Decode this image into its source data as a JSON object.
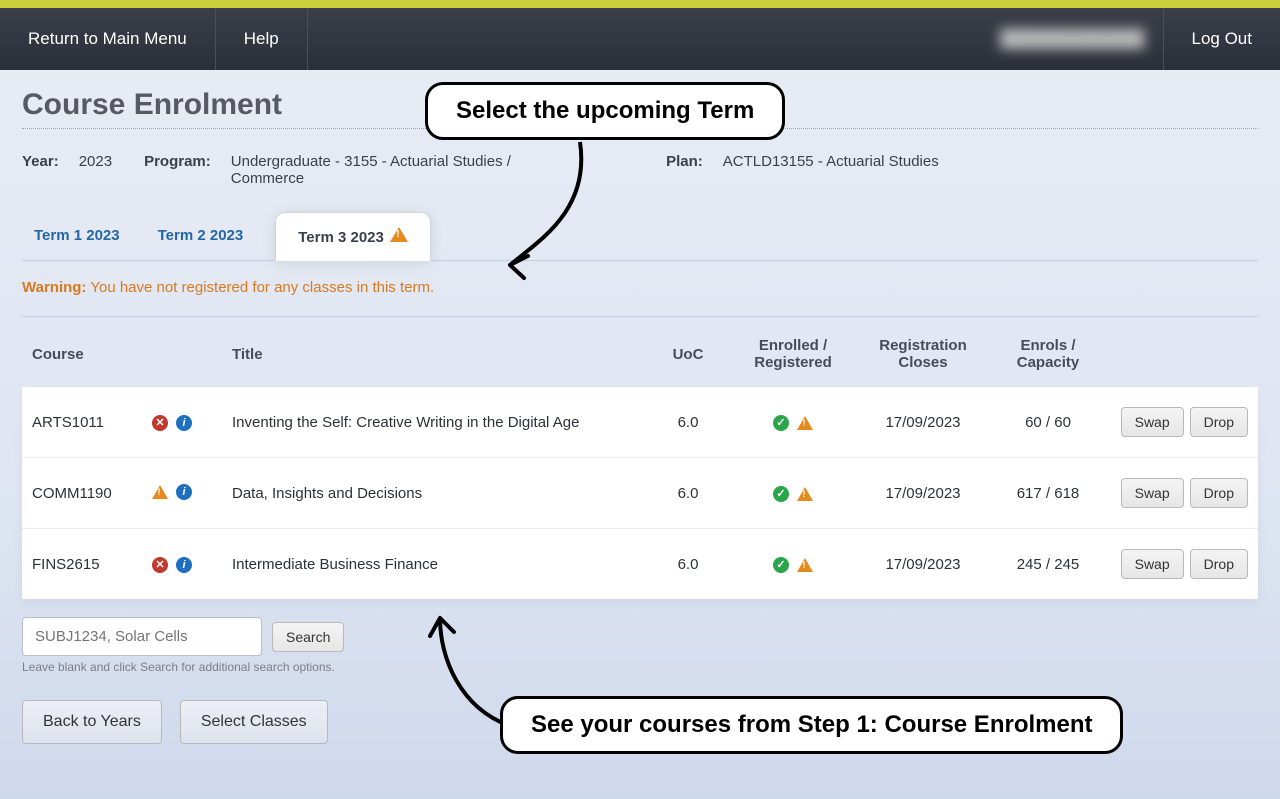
{
  "topnav": {
    "return_label": "Return to Main Menu",
    "help_label": "Help",
    "user_blurred": "████████████",
    "logout_label": "Log Out"
  },
  "page_title": "Course Enrolment",
  "info": {
    "year_label": "Year:",
    "year_value": "2023",
    "program_label": "Program:",
    "program_value": "Undergraduate - 3155 - Actuarial Studies / Commerce",
    "plan_label": "Plan:",
    "plan_value": "ACTLD13155 - Actuarial Studies"
  },
  "tabs": [
    {
      "label": "Term 1 2023",
      "active": false,
      "warn": false
    },
    {
      "label": "Term 2 2023",
      "active": false,
      "warn": false
    },
    {
      "label": "Term 3 2023",
      "active": true,
      "warn": true
    }
  ],
  "warning": {
    "strong": "Warning:",
    "text": "You have not registered for any classes in this term."
  },
  "table": {
    "headers": {
      "course": "Course",
      "title": "Title",
      "uoc": "UoC",
      "enrolled": "Enrolled / Registered",
      "reg_closes": "Registration Closes",
      "capacity": "Enrols / Capacity"
    },
    "rows": [
      {
        "course": "ARTS1011",
        "status_icon": "error",
        "title": "Inventing the Self: Creative Writing in the Digital Age",
        "uoc": "6.0",
        "reg_closes": "17/09/2023",
        "capacity": "60 / 60"
      },
      {
        "course": "COMM1190",
        "status_icon": "warn",
        "title": "Data, Insights and Decisions",
        "uoc": "6.0",
        "reg_closes": "17/09/2023",
        "capacity": "617 / 618"
      },
      {
        "course": "FINS2615",
        "status_icon": "error",
        "title": "Intermediate Business Finance",
        "uoc": "6.0",
        "reg_closes": "17/09/2023",
        "capacity": "245 / 245"
      }
    ],
    "swap_label": "Swap",
    "drop_label": "Drop"
  },
  "search": {
    "placeholder": "SUBJ1234, Solar Cells",
    "button": "Search",
    "hint": "Leave blank and click Search for additional search options."
  },
  "bottom": {
    "back": "Back to Years",
    "select": "Select Classes"
  },
  "callouts": {
    "upper": "Select the upcoming Term",
    "lower": "See your courses from Step 1: Course Enrolment"
  }
}
